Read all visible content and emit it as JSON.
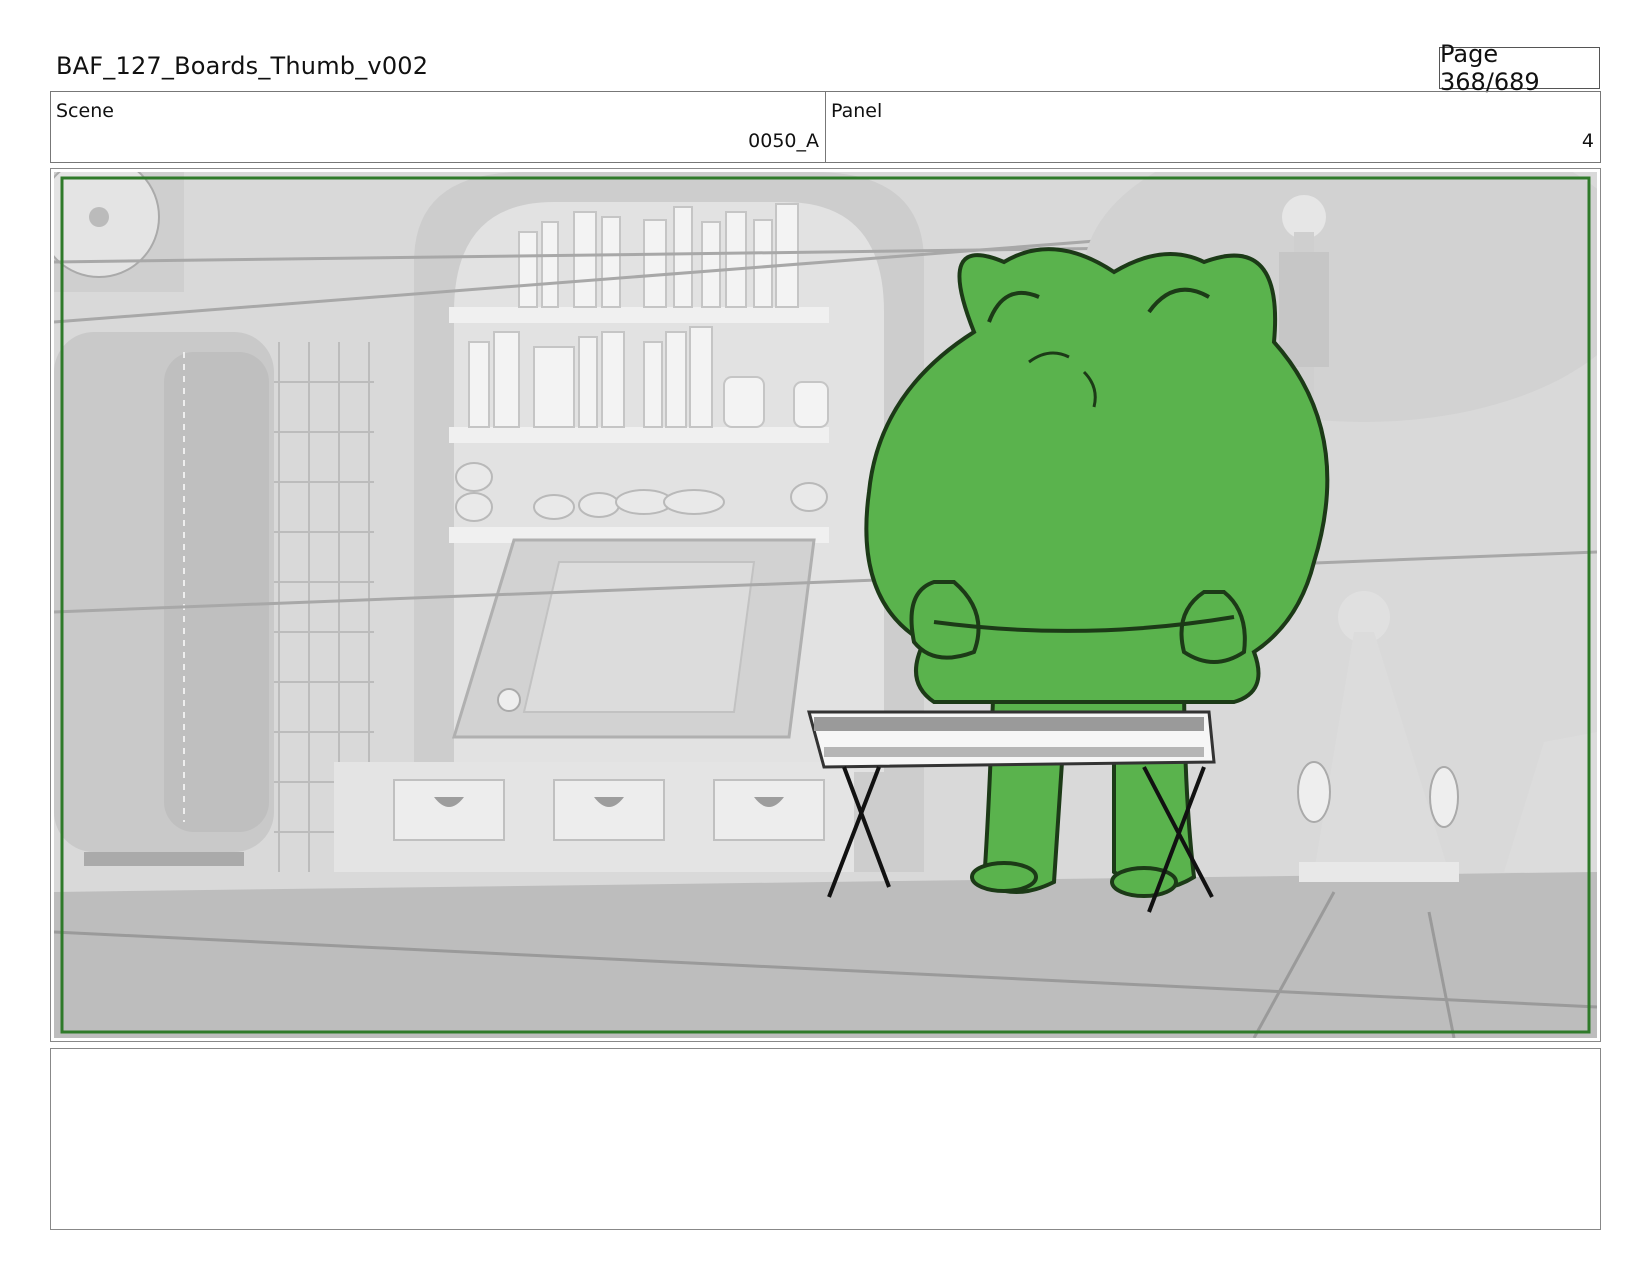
{
  "header": {
    "document_title": "BAF_127_Boards_Thumb_v002",
    "page_label": "Page 368/689"
  },
  "info": {
    "scene_label": "Scene",
    "scene_value": "0050_A",
    "panel_label": "Panel",
    "panel_value": "4"
  },
  "frame": {
    "description_hint": "storyboard-panel",
    "colors": {
      "character_fill": "#5ab34d",
      "character_outline": "#1c3a17",
      "safe_frame": "#2f7a2a",
      "background": "#d8d8d8"
    }
  },
  "notes": {
    "text": ""
  }
}
